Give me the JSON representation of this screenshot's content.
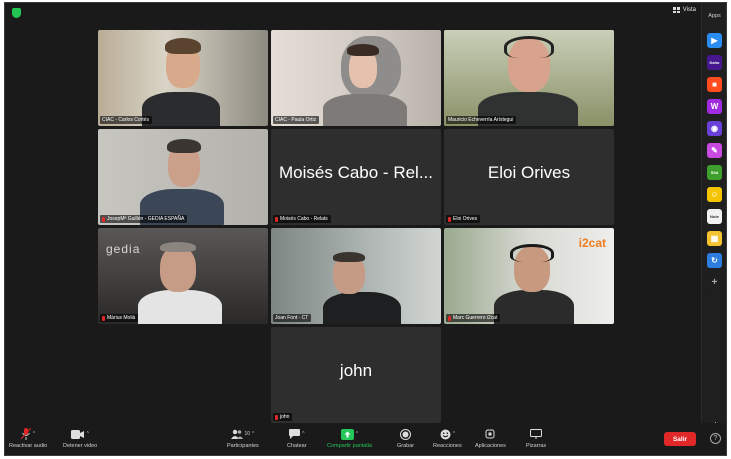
{
  "top_bar": {
    "view_label": "Vista"
  },
  "apps_panel": {
    "title": "Apps",
    "apps": [
      {
        "icon": "play-app-icon",
        "color": "#2a8cf0",
        "glyph": "▶"
      },
      {
        "icon": "kahoot-app-icon",
        "color": "#46178f",
        "glyph": "Kahoot!"
      },
      {
        "icon": "red-app-icon",
        "color": "#ff4b1e",
        "glyph": "■"
      },
      {
        "icon": "w-app-icon",
        "color": "#a12be0",
        "glyph": "W"
      },
      {
        "icon": "purple-app-icon",
        "color": "#6b40d8",
        "glyph": "◉"
      },
      {
        "icon": "pink-app-icon",
        "color": "#c74be0",
        "glyph": "✎"
      },
      {
        "icon": "slido-app-icon",
        "color": "#3f9f2c",
        "glyph": "Slido"
      },
      {
        "icon": "yellow-app-icon",
        "color": "#f5c400",
        "glyph": "☺"
      },
      {
        "icon": "notes-app-icon",
        "color": "#f2f2f2",
        "glyph": "Notes"
      },
      {
        "icon": "grid-app-icon",
        "color": "#f4c430",
        "glyph": "▦"
      },
      {
        "icon": "refresh-app-icon",
        "color": "#2d7de0",
        "glyph": "↻"
      },
      {
        "icon": "add-app-icon",
        "color": "#1f1f1f",
        "glyph": "+"
      }
    ]
  },
  "participants": [
    {
      "name": "CIAC - Carlos Cortés",
      "kind": "video",
      "bg": "#a5977c"
    },
    {
      "name": "CIAC - Paula Ortiz",
      "kind": "video",
      "bg": "#cfc9c2"
    },
    {
      "name": "Mauricio Echeverría Arístegui",
      "kind": "video",
      "bg": "#8a9167",
      "active": true
    },
    {
      "name": "JosepMª Guillén - GEDIA ESPAÑA",
      "kind": "video",
      "bg": "#b8b6b0"
    },
    {
      "name": "Moisés Cabo - Relats",
      "display": "Moisés Cabo - Rel...",
      "kind": "text"
    },
    {
      "name": "Eloi Orives",
      "display": "Eloi Orives",
      "kind": "text"
    },
    {
      "name": "Màrius Molià",
      "kind": "video",
      "bg": "#4a4846",
      "brand": "gedia"
    },
    {
      "name": "Joan Font - CT",
      "kind": "video",
      "bg": "#9aa2a0"
    },
    {
      "name": "Marc Guerrero i2cat",
      "kind": "video",
      "bg": "#b7bdb0",
      "brand": "i2cat"
    },
    {
      "name": "john",
      "display": "john",
      "kind": "text"
    }
  ],
  "toolbar": {
    "unmute_label": "Reactivar audio",
    "stop_video_label": "Detener video",
    "participants_label": "Participantes",
    "participants_count": "10",
    "chat_label": "Chatear",
    "share_label": "Compartir pantalla",
    "record_label": "Grabar",
    "reactions_label": "Reacciones",
    "apps_label": "Aplicaciones",
    "whiteboards_label": "Pizarras",
    "leave_label": "Salir"
  },
  "brand_text": {
    "gedia": "gedia",
    "i2cat": "i2cat"
  }
}
